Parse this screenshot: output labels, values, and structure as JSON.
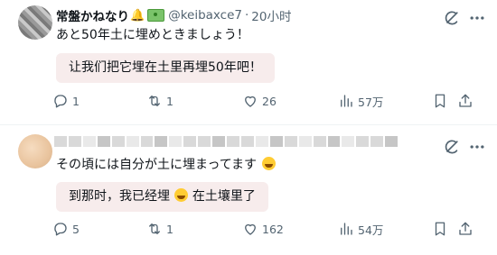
{
  "posts": [
    {
      "display_name": "常盤かねなり",
      "bell_emoji": "🔔",
      "handle": "@keibaxce7",
      "separator": "·",
      "time": "20小时",
      "text": "あと50年土に埋めときましょう！",
      "translation": "让我们把它埋在土里再埋50年吧！",
      "stats": {
        "replies": "1",
        "reposts": "1",
        "likes": "26",
        "views": "57万"
      }
    },
    {
      "text": "その頃には自分が土に埋まってます",
      "translation_part1": "到那时，我已经埋",
      "translation_part2": "在土壤里了",
      "stats": {
        "replies": "5",
        "reposts": "1",
        "likes": "162",
        "views": "54万"
      }
    }
  ],
  "icons": [
    "grok-icon",
    "more-icon",
    "reply-icon",
    "repost-icon",
    "like-icon",
    "views-icon",
    "bookmark-icon",
    "share-icon"
  ]
}
